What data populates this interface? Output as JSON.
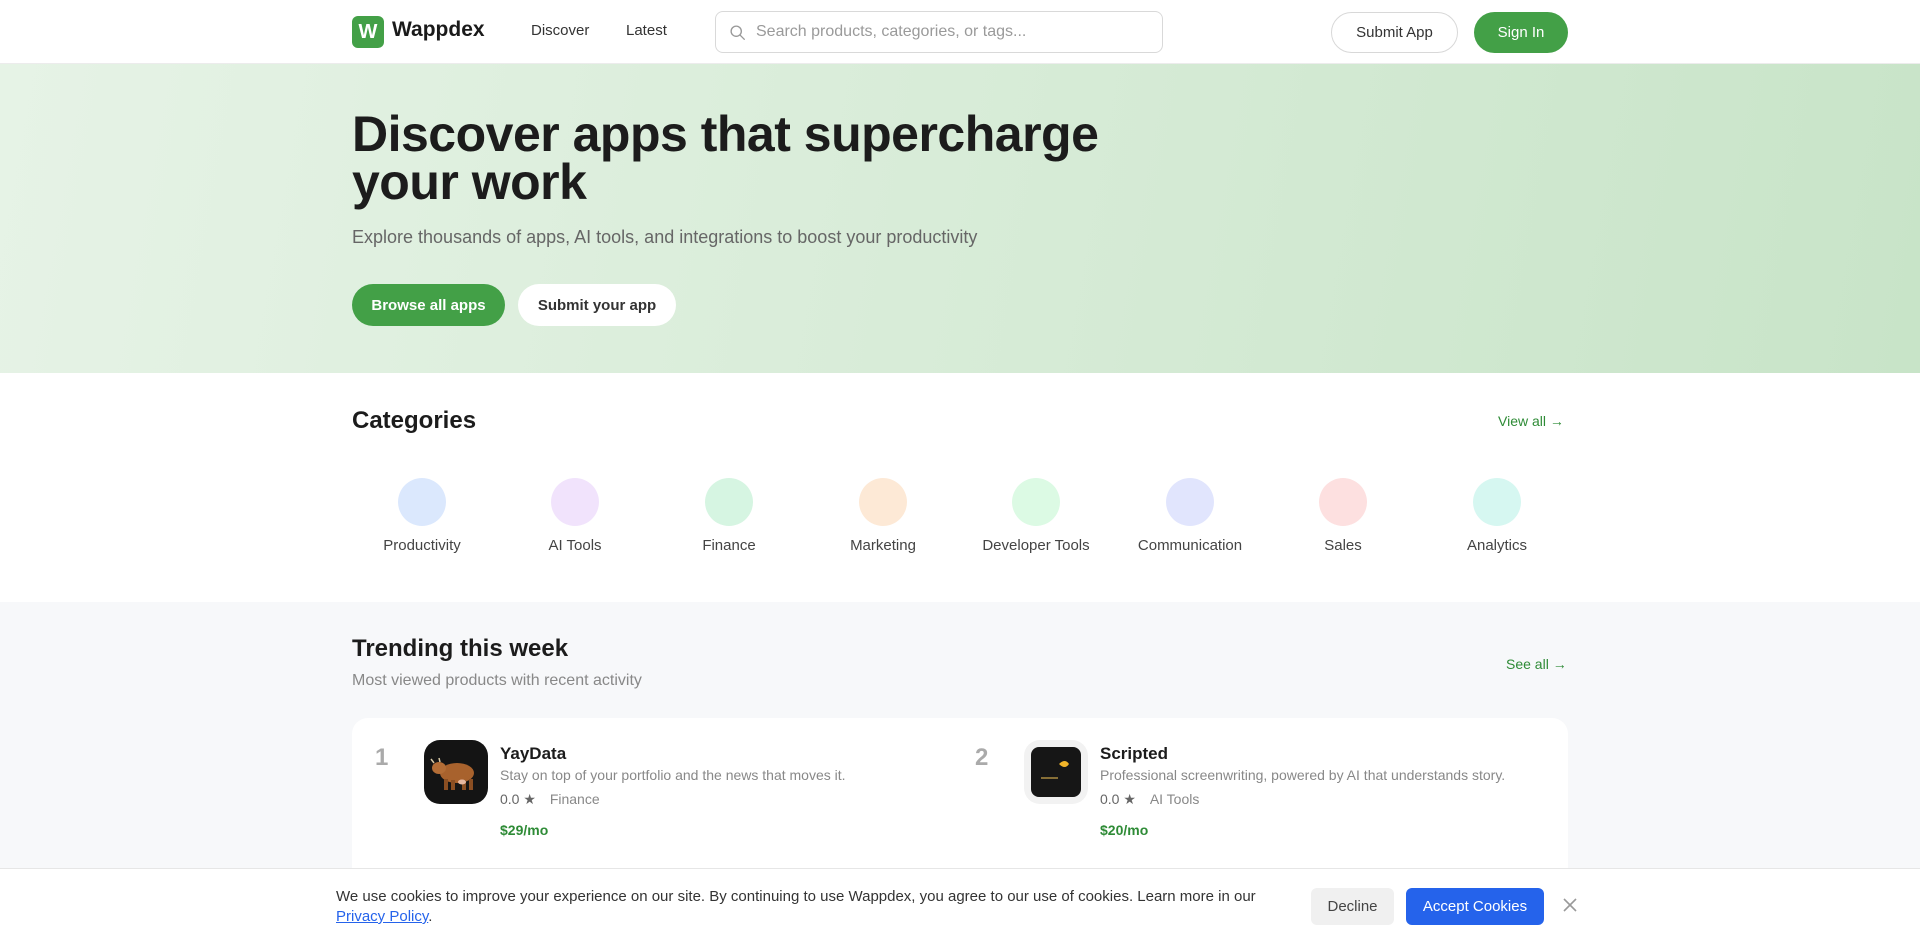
{
  "header": {
    "logo_letter": "W",
    "logo_text": "Wappdex",
    "nav": [
      "Discover",
      "Latest"
    ],
    "search_placeholder": "Search products, categories, or tags...",
    "submit_label": "Submit App",
    "signin_label": "Sign In",
    "icons": {
      "search": "search-icon"
    },
    "accent_color": "#43a047"
  },
  "hero": {
    "title": "Discover apps that supercharge your work",
    "subtitle": "Explore thousands of apps, AI tools, and integrations to boost your productivity",
    "primary_label": "Browse all apps",
    "secondary_label": "Submit your app"
  },
  "categories": {
    "title": "Categories",
    "view_all": "View all →",
    "items": [
      {
        "label": "Productivity",
        "color": "#dbe8fd"
      },
      {
        "label": "AI Tools",
        "color": "#f1e3fc"
      },
      {
        "label": "Finance",
        "color": "#d6f5e2"
      },
      {
        "label": "Marketing",
        "color": "#fde9d6"
      },
      {
        "label": "Developer Tools",
        "color": "#dcfae4"
      },
      {
        "label": "Communication",
        "color": "#e1e5fd"
      },
      {
        "label": "Sales",
        "color": "#fde0e0"
      },
      {
        "label": "Analytics",
        "color": "#d6f7f1"
      }
    ]
  },
  "trending": {
    "title": "Trending this week",
    "subtitle": "Most viewed products with recent activity",
    "see_all": "See all →",
    "items": [
      {
        "rank": "1",
        "name": "YayData",
        "description": "Stay on top of your portfolio and the news that moves it.",
        "rating": "0.0",
        "category": "Finance",
        "price": "$29/mo",
        "icon": "cow-icon"
      },
      {
        "rank": "2",
        "name": "Scripted",
        "description": "Professional screenwriting, powered by AI that understands story.",
        "rating": "0.0",
        "category": "AI Tools",
        "price": "$20/mo",
        "icon": "scripted-logo-icon"
      }
    ]
  },
  "cookie": {
    "text": "We use cookies to improve your experience on our site. By continuing to use Wappdex, you agree to our use of cookies. Learn more in our ",
    "link": "Privacy Policy",
    "after_link": ".",
    "decline_label": "Decline",
    "accept_label": "Accept Cookies",
    "accept_color": "#2563eb"
  }
}
